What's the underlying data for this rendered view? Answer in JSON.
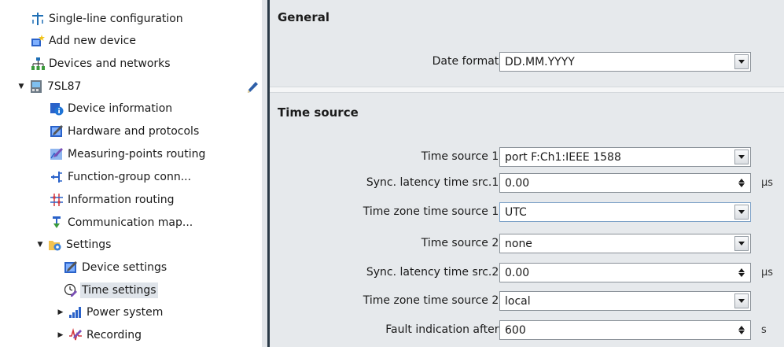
{
  "tree": {
    "items": [
      {
        "label": "Single-line configuration",
        "icon": "single-line-icon"
      },
      {
        "label": "Add new device",
        "icon": "add-device-icon"
      },
      {
        "label": "Devices and networks",
        "icon": "network-icon"
      },
      {
        "label": "7SL87",
        "icon": "device-icon",
        "expanded": true
      },
      {
        "label": "Device information",
        "icon": "info-icon"
      },
      {
        "label": "Hardware and protocols",
        "icon": "hardware-icon"
      },
      {
        "label": "Measuring-points routing",
        "icon": "measuring-icon"
      },
      {
        "label": "Function-group conn...",
        "icon": "function-group-icon"
      },
      {
        "label": "Information routing",
        "icon": "routing-icon"
      },
      {
        "label": "Communication map...",
        "icon": "communication-icon"
      },
      {
        "label": "Settings",
        "icon": "settings-folder-icon",
        "expanded": true
      },
      {
        "label": "Device settings",
        "icon": "device-settings-icon"
      },
      {
        "label": "Time settings",
        "icon": "clock-icon",
        "selected": true
      },
      {
        "label": "Power system",
        "icon": "power-system-icon",
        "expanded": false
      },
      {
        "label": "Recording",
        "icon": "recording-icon",
        "expanded": false
      }
    ]
  },
  "general": {
    "title": "General",
    "date_format": {
      "label": "Date format:",
      "value": "DD.MM.YYYY"
    }
  },
  "time_source": {
    "title": "Time source",
    "rows": [
      {
        "label": "Time source 1:",
        "value": "port F:Ch1:IEEE 1588",
        "control": "dropdown",
        "unit": ""
      },
      {
        "label": "Sync. latency time src.1:",
        "value": "0.00",
        "control": "spinner",
        "unit": "µs"
      },
      {
        "label": "Time zone time source 1:",
        "value": "UTC",
        "control": "dropdown",
        "unit": "",
        "focused": true
      },
      {
        "label": "Time source 2:",
        "value": "none",
        "control": "dropdown",
        "unit": ""
      },
      {
        "label": "Sync. latency time src.2:",
        "value": "0.00",
        "control": "spinner",
        "unit": "µs"
      },
      {
        "label": "Time zone time source 2:",
        "value": "local",
        "control": "dropdown",
        "unit": ""
      },
      {
        "label": "Fault indication after:",
        "value": "600",
        "control": "spinner",
        "unit": "s"
      }
    ]
  },
  "colors": {
    "content_bg": "#e6e9ec",
    "separator": "#2b3a47",
    "selected_bg": "#dfe4ea"
  }
}
